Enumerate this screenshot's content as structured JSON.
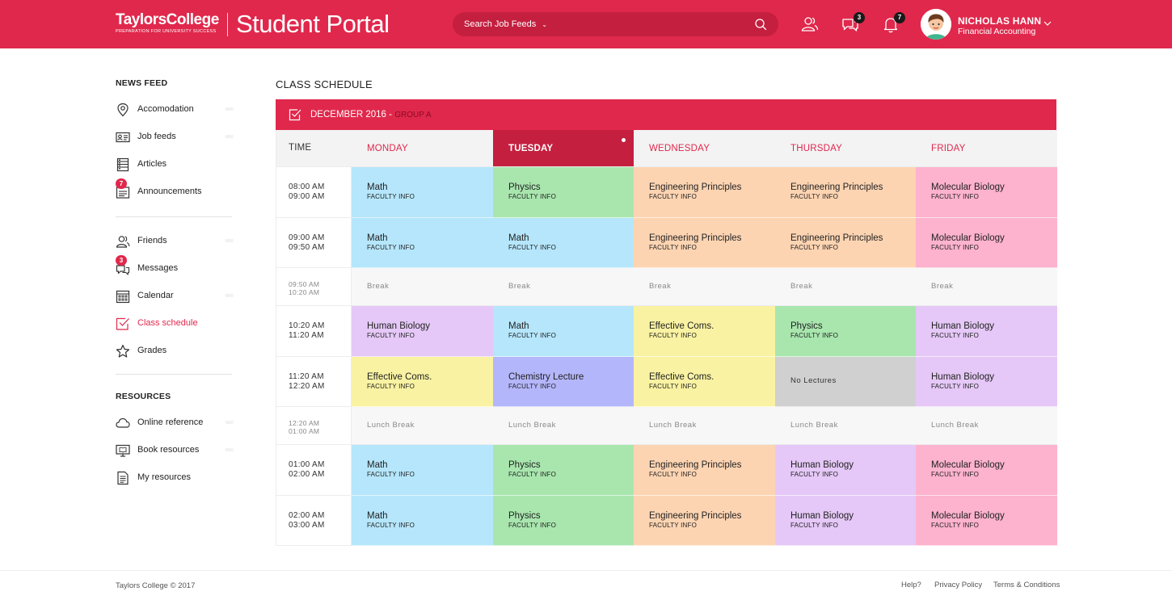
{
  "header": {
    "brand": "TaylorsCollege",
    "tagline": "PREPARATION FOR UNIVERSITY SUCCESS",
    "portal_title": "Student Portal",
    "search_dropdown": "Search Job Feeds",
    "search_placeholder": "",
    "messages_badge": "3",
    "notifications_badge": "7",
    "user_name": "NICHOLAS HANN",
    "user_dept": "Financial Accounting",
    "accent_color": "#e0284c"
  },
  "sidebar": {
    "news_feed_heading": "NEWS FEED",
    "resources_heading": "RESOURCES",
    "items": [
      {
        "label": "Accomodation",
        "icon": "location-pin-icon"
      },
      {
        "label": "Job feeds",
        "icon": "id-card-icon"
      },
      {
        "label": "Articles",
        "icon": "articles-icon"
      },
      {
        "label": "Announcements",
        "icon": "announcement-icon",
        "badge": "7"
      },
      {
        "label": "Friends",
        "icon": "friends-icon"
      },
      {
        "label": "Messages",
        "icon": "messages-icon",
        "badge": "3"
      },
      {
        "label": "Calendar",
        "icon": "calendar-icon"
      },
      {
        "label": "Class schedule",
        "icon": "schedule-check-icon",
        "active": true
      },
      {
        "label": "Grades",
        "icon": "star-icon"
      },
      {
        "label": "Online reference",
        "icon": "cloud-icon"
      },
      {
        "label": "Book resources",
        "icon": "monitor-book-icon"
      },
      {
        "label": "My resources",
        "icon": "document-icon"
      }
    ]
  },
  "schedule": {
    "page_title": "CLASS SCHEDULE",
    "month": "DECEMBER 2016",
    "separator": " - ",
    "group": "GROUP A",
    "time_header": "TIME",
    "days": [
      "MONDAY",
      "TUESDAY",
      "WEDNESDAY",
      "THURSDAY",
      "FRIDAY"
    ],
    "today_index": 1,
    "faculty_label": "FACULTY INFO",
    "rows": [
      {
        "start": "08:00 AM",
        "end": "09:00 AM",
        "type": "class",
        "cells": [
          {
            "subject": "Math",
            "color": "#b5e6fb"
          },
          {
            "subject": "Physics",
            "color": "#a8e6ae"
          },
          {
            "subject": "Engineering Principles",
            "color": "#fdd4b2"
          },
          {
            "subject": "Engineering Principles",
            "color": "#fdd4b2"
          },
          {
            "subject": "Molecular Biology",
            "color": "#fdb2cd"
          }
        ]
      },
      {
        "start": "09:00 AM",
        "end": "09:50 AM",
        "type": "class",
        "cells": [
          {
            "subject": "Math",
            "color": "#b5e6fb"
          },
          {
            "subject": "Math",
            "color": "#b5e6fb"
          },
          {
            "subject": "Engineering Principles",
            "color": "#fdd4b2"
          },
          {
            "subject": "Engineering Principles",
            "color": "#fdd4b2"
          },
          {
            "subject": "Molecular Biology",
            "color": "#fdb2cd"
          }
        ]
      },
      {
        "start": "09:50 AM",
        "end": "10:20 AM",
        "type": "break",
        "label": "Break"
      },
      {
        "start": "10:20  AM",
        "end": "11:20  AM",
        "type": "class",
        "cells": [
          {
            "subject": "Human Biology",
            "color": "#e5c8f7"
          },
          {
            "subject": "Math",
            "color": "#b5e6fb"
          },
          {
            "subject": "Effective Coms.",
            "color": "#f9f2a2"
          },
          {
            "subject": "Physics",
            "color": "#a8e6ae"
          },
          {
            "subject": "Human Biology",
            "color": "#e5c8f7"
          }
        ]
      },
      {
        "start": "11:20   AM",
        "end": "12:20  AM",
        "type": "class",
        "cells": [
          {
            "subject": "Effective Coms.",
            "color": "#f9f2a2"
          },
          {
            "subject": "Chemistry Lecture",
            "color": "#b4b6fb"
          },
          {
            "subject": "Effective Coms.",
            "color": "#f9f2a2"
          },
          {
            "none": "No Lectures",
            "color": "#d0d0d0"
          },
          {
            "subject": "Human Biology",
            "color": "#e5c8f7"
          }
        ]
      },
      {
        "start": "12:20  AM",
        "end": "01:00  AM",
        "type": "break",
        "label": "Lunch Break"
      },
      {
        "start": "01:00  AM",
        "end": "02:00 AM",
        "type": "class",
        "cells": [
          {
            "subject": "Math",
            "color": "#b5e6fb"
          },
          {
            "subject": "Physics",
            "color": "#a8e6ae"
          },
          {
            "subject": "Engineering Principles",
            "color": "#fdd4b2"
          },
          {
            "subject": "Human Biology",
            "color": "#e5c8f7"
          },
          {
            "subject": "Molecular Biology",
            "color": "#fdb2cd"
          }
        ]
      },
      {
        "start": "02:00 AM",
        "end": "03:00 AM",
        "type": "class",
        "cells": [
          {
            "subject": "Math",
            "color": "#b5e6fb"
          },
          {
            "subject": "Physics",
            "color": "#a8e6ae"
          },
          {
            "subject": "Engineering Principles",
            "color": "#fdd4b2"
          },
          {
            "subject": "Human Biology",
            "color": "#e5c8f7"
          },
          {
            "subject": "Molecular Biology",
            "color": "#fdb2cd"
          }
        ]
      }
    ]
  },
  "footer": {
    "copyright": "Taylors College © 2017",
    "links": [
      "Help?",
      "Privacy Policy",
      "Terms & Conditions"
    ]
  }
}
